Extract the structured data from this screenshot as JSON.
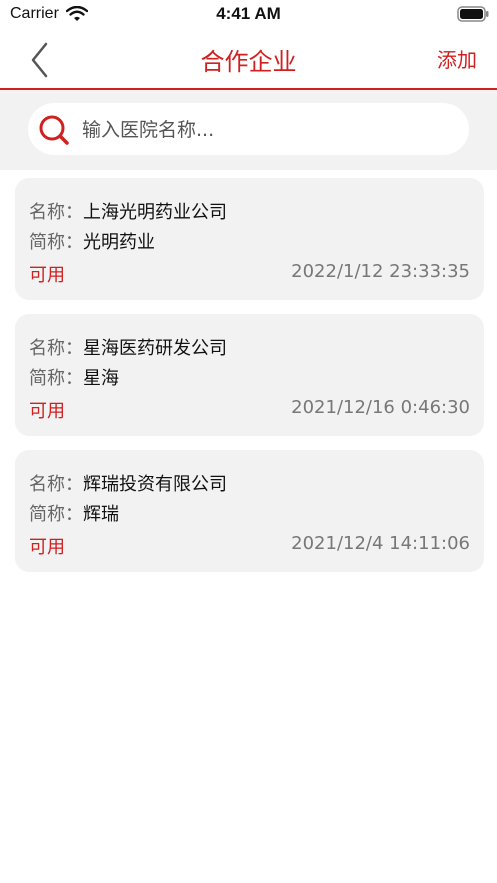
{
  "status_bar": {
    "carrier": "Carrier",
    "time": "4:41 AM"
  },
  "nav": {
    "title": "合作企业",
    "add_label": "添加"
  },
  "search": {
    "placeholder": "输入医院名称..."
  },
  "labels": {
    "name": "名称：",
    "short": "简称："
  },
  "companies": [
    {
      "name": "上海光明药业公司",
      "short_name": "光明药业",
      "status": "可用",
      "date": "2022/1/12 23:33:35"
    },
    {
      "name": "星海医药研发公司",
      "short_name": "星海",
      "status": "可用",
      "date": "2021/12/16 0:46:30"
    },
    {
      "name": "辉瑞投资有限公司",
      "short_name": "辉瑞",
      "status": "可用",
      "date": "2021/12/4 14:11:06"
    }
  ],
  "colors": {
    "accent": "#d02020",
    "card_bg": "#f2f2f2"
  }
}
